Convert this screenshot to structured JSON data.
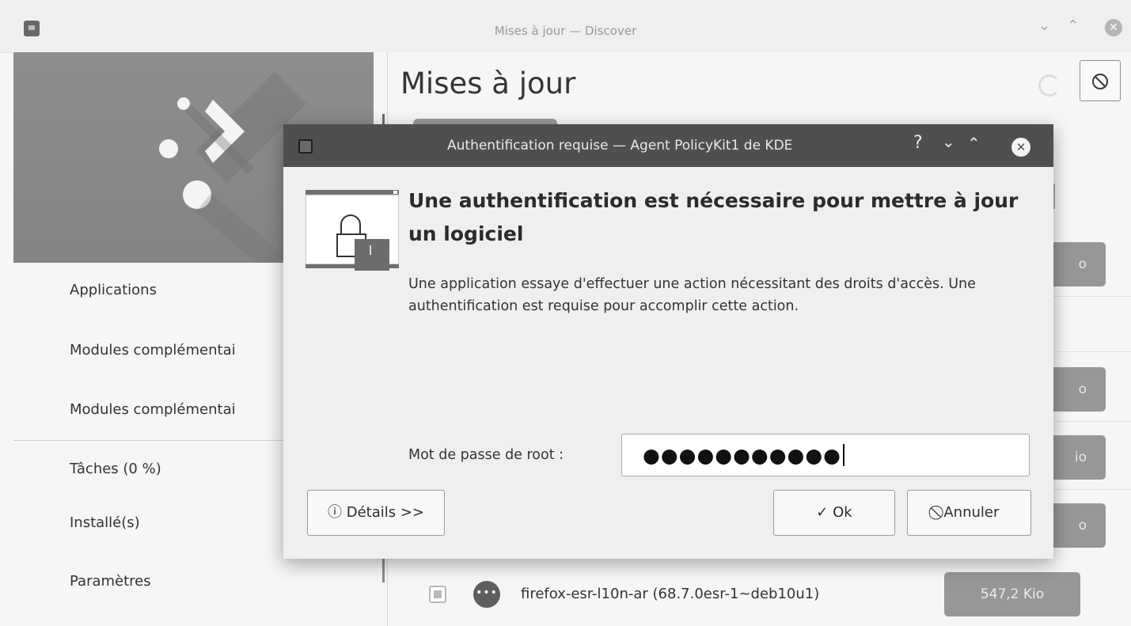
{
  "main_window": {
    "title": "Mises à jour — Discover",
    "controls": {
      "minimize": "⌄",
      "maximize": "⌃",
      "close": "✕"
    }
  },
  "sidebar": {
    "items": [
      {
        "label": "Applications"
      },
      {
        "label": "Modules complémentai"
      },
      {
        "label": "Modules complémentai"
      },
      {
        "label": "Tâches (0 %)"
      },
      {
        "label": "Installé(s)"
      },
      {
        "label": "Paramètres"
      }
    ]
  },
  "content": {
    "title": "Mises à jour",
    "cancel_icon": "⃠",
    "size_labels": [
      "o",
      "o",
      "io",
      "o"
    ],
    "last_row": {
      "icon_glyph": "•••",
      "name": "firefox-esr-l10n-ar (68.7.0esr-1~deb10u1)",
      "size": "547,2 Kio"
    }
  },
  "dialog": {
    "title": "Authentification requise — Agent PolicyKit1 de KDE",
    "controls": {
      "help": "?",
      "minimize": "⌄",
      "maximize": "⌃",
      "close": "✕"
    },
    "headline": "Une authentification est nécessaire pour mettre à jour un logiciel",
    "description": "Une application essaye d'effectuer une action nécessitant des droits d'accès. Une authentification est requise pour accomplir cette action.",
    "password_label": "Mot de passe de root :",
    "password_value": "●●●●●●●●●●●",
    "details_button": "ⓘ Détails >>",
    "ok_button": "✓ Ok",
    "cancel_button": "⃠ Annuler"
  }
}
